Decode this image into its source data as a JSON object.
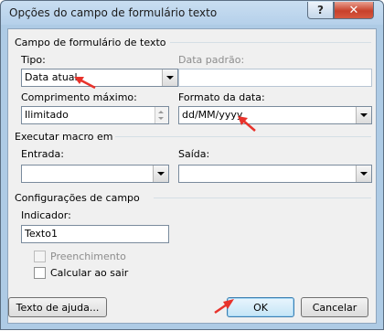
{
  "window": {
    "title": "Opções do campo de formulário texto",
    "help_glyph": "?",
    "close_glyph": "✕"
  },
  "text_field_section": {
    "title": "Campo de formulário de texto",
    "type_label": "Tipo:",
    "type_value": "Data atual",
    "default_date_label": "Data padrão:",
    "default_date_value": "",
    "max_length_label": "Comprimento máximo:",
    "max_length_value": "Ilimitado",
    "date_format_label": "Formato da data:",
    "date_format_value": "dd/MM/yyyy"
  },
  "macro_section": {
    "title": "Executar macro em",
    "entry_label": "Entrada:",
    "entry_value": "",
    "exit_label": "Saída:",
    "exit_value": ""
  },
  "field_settings_section": {
    "title": "Configurações de campo",
    "bookmark_label": "Indicador:",
    "bookmark_value": "Texto1",
    "fill_in_label": "Preenchimento",
    "fill_in_checked": false,
    "calculate_on_exit_label": "Calcular ao sair",
    "calculate_on_exit_checked": false
  },
  "buttons": {
    "help_text": "Texto de ajuda...",
    "ok": "OK",
    "cancel": "Cancelar"
  },
  "colors": {
    "annotation_arrow": "#e8322b",
    "window_frame": "#aecbe5",
    "close_button": "#c8412b"
  }
}
